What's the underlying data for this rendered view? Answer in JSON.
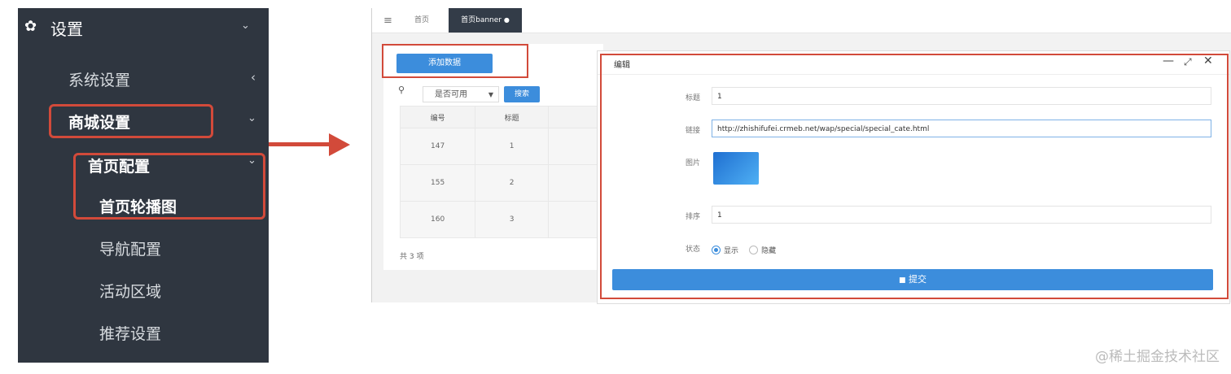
{
  "sidebar": {
    "header_label": "设置",
    "items": [
      {
        "label": "系统设置"
      },
      {
        "label": "商城设置"
      },
      {
        "label": "首页配置"
      },
      {
        "label": "首页轮播图"
      },
      {
        "label": "导航配置"
      },
      {
        "label": "活动区域"
      },
      {
        "label": "推荐设置"
      }
    ]
  },
  "admin": {
    "tabs": [
      {
        "label": "首页"
      },
      {
        "label": "首页banner"
      }
    ],
    "add_button": "添加数据",
    "filter_select": "是否可用",
    "search_button": "搜索",
    "table": {
      "columns": [
        "编号",
        "标题"
      ],
      "rows": [
        [
          "147",
          "1"
        ],
        [
          "155",
          "2"
        ],
        [
          "160",
          "3"
        ]
      ]
    },
    "total": "共 3 项"
  },
  "dialog": {
    "title": "编辑",
    "fields": {
      "title_label": "标题",
      "title_value": "1",
      "link_label": "链接",
      "link_value": "http://zhishifufei.crmeb.net/wap/special/special_cate.html",
      "image_label": "图片",
      "sort_label": "排序",
      "sort_value": "1",
      "status_label": "状态",
      "status_options": [
        "显示",
        "隐藏"
      ],
      "status_selected": "显示"
    },
    "submit_button": "提交"
  },
  "watermark": "@稀土掘金技术社区",
  "colors": {
    "sidebar_bg": "#2f3640",
    "highlight": "#d24a3a",
    "primary": "#3c8ddc"
  }
}
